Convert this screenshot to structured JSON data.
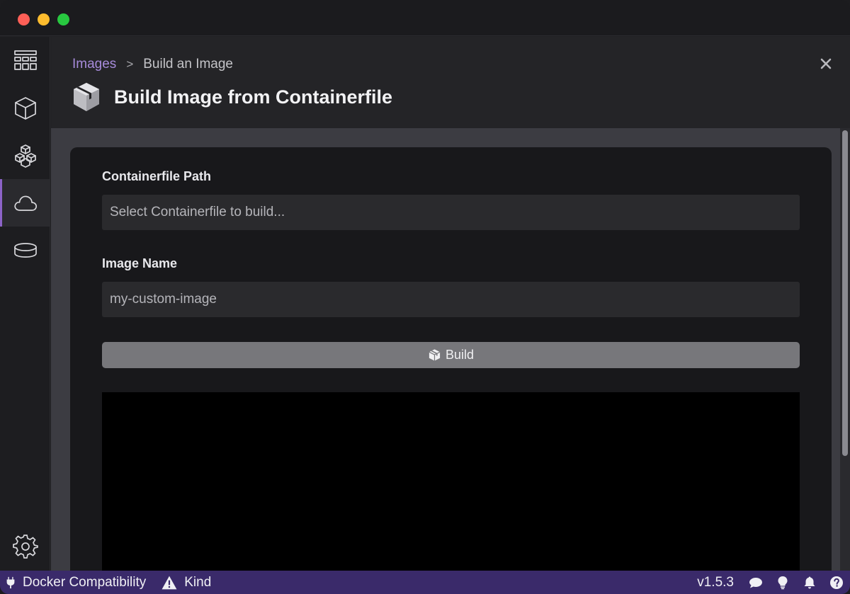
{
  "breadcrumb": {
    "parent": "Images",
    "separator": ">",
    "current": "Build an Image"
  },
  "page": {
    "title": "Build Image from Containerfile"
  },
  "form": {
    "containerfile_label": "Containerfile Path",
    "containerfile_placeholder": "Select Containerfile to build...",
    "containerfile_value": "",
    "image_name_label": "Image Name",
    "image_name_placeholder": "my-custom-image",
    "image_name_value": "",
    "build_label": "Build"
  },
  "nav": {
    "items": [
      {
        "icon": "dashboard-icon"
      },
      {
        "icon": "container-cube-icon"
      },
      {
        "icon": "pods-cubes-icon"
      },
      {
        "icon": "cloud-images-icon",
        "active": true
      },
      {
        "icon": "volume-disk-icon"
      }
    ],
    "settings_icon": "gear-icon"
  },
  "statusbar": {
    "docker_compat": "Docker Compatibility",
    "kind": "Kind",
    "version": "v1.5.3",
    "icons": [
      "plug-icon",
      "warning-icon",
      "chat-icon",
      "lightbulb-icon",
      "bell-icon",
      "help-icon"
    ]
  },
  "colors": {
    "accent": "#8c63c8",
    "breadcrumb_link": "#a78bdb",
    "statusbar_bg": "#3a2a6a",
    "terminal_bg": "#000000",
    "build_button": "#77777b"
  }
}
